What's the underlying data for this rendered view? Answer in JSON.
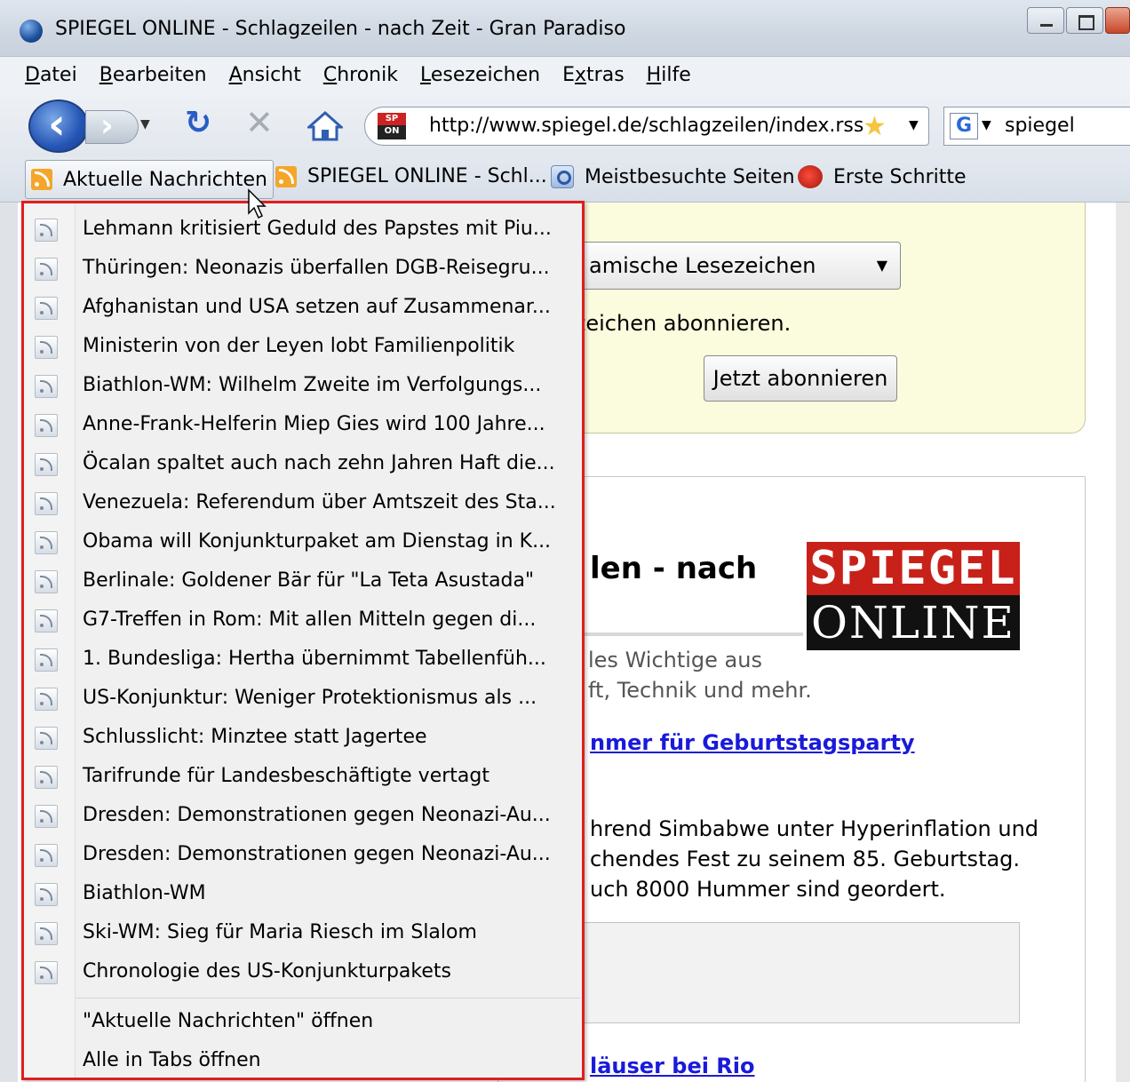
{
  "window": {
    "title": "SPIEGEL ONLINE - Schlagzeilen - nach Zeit - Gran Paradiso"
  },
  "menubar": {
    "items": [
      {
        "underline": "D",
        "rest": "atei"
      },
      {
        "underline": "B",
        "rest": "earbeiten"
      },
      {
        "underline": "A",
        "rest": "nsicht"
      },
      {
        "underline": "C",
        "rest": "hronik"
      },
      {
        "underline": "L",
        "rest": "esezeichen"
      },
      {
        "pre": "E",
        "underline": "x",
        "rest": "tras"
      },
      {
        "underline": "H",
        "rest": "ilfe"
      }
    ]
  },
  "navbar": {
    "url": "http://www.spiegel.de/schlagzeilen/index.rss",
    "favicon_top": "SP",
    "favicon_bottom": "ON",
    "search_value": "spiegel",
    "search_engine_letter": "G"
  },
  "bookmarks": {
    "items": [
      {
        "label": "Aktuelle Nachrichten",
        "icon": "rss-icon"
      },
      {
        "label": "SPIEGEL ONLINE - Schl...",
        "icon": "rss-icon"
      },
      {
        "label": "Meistbesuchte Seiten",
        "icon": "magnifier-icon"
      },
      {
        "label": "Erste Schritte",
        "icon": "firefox-icon"
      }
    ]
  },
  "page": {
    "select_value": "amische Lesezeichen",
    "subscribe_text": "ezeichen abonnieren.",
    "subscribe_button": "Jetzt abonnieren",
    "headline": "len - nach",
    "logo_top": "SPIEGEL",
    "logo_bottom": "ONLINE",
    "desc_line1": "les Wichtige aus",
    "desc_line2": "ft, Technik und mehr.",
    "link1": "nmer für Geburtstagsparty",
    "body_line1": "hrend Simbabwe unter Hyperinflation und",
    "body_line2": "chendes Fest zu seinem 85. Geburtstag.",
    "body_line3": "uch 8000 Hummer sind geordert.",
    "link2": "läuser bei Rio"
  },
  "dropdown": {
    "items": [
      "Lehmann kritisiert Geduld des Papstes mit Piu...",
      "Thüringen: Neonazis überfallen DGB-Reisegru...",
      "Afghanistan und USA setzen auf Zusammenar...",
      "Ministerin von der Leyen lobt Familienpolitik",
      "Biathlon-WM: Wilhelm Zweite im Verfolgungs...",
      "Anne-Frank-Helferin Miep Gies wird 100 Jahre...",
      "Öcalan spaltet auch nach zehn Jahren Haft die...",
      "Venezuela: Referendum über Amtszeit des Sta...",
      "Obama will Konjunkturpaket am Dienstag in K...",
      "Berlinale: Goldener Bär für \"La Teta Asustada\"",
      "G7-Treffen in Rom: Mit allen Mitteln gegen di...",
      "1. Bundesliga: Hertha übernimmt Tabellenfüh...",
      "US-Konjunktur: Weniger Protektionismus als ...",
      "Schlusslicht: Minztee statt Jagertee",
      "Tarifrunde für Landesbeschäftigte vertagt",
      "Dresden: Demonstrationen gegen Neonazi-Au...",
      "Dresden: Demonstrationen gegen Neonazi-Au...",
      "Biathlon-WM",
      "Ski-WM: Sieg für Maria Riesch im Slalom",
      "Chronologie des US-Konjunkturpakets"
    ],
    "actions": [
      "\"Aktuelle Nachrichten\" öffnen",
      "Alle in Tabs öffnen"
    ],
    "highlight_color": "#e01e1e"
  }
}
